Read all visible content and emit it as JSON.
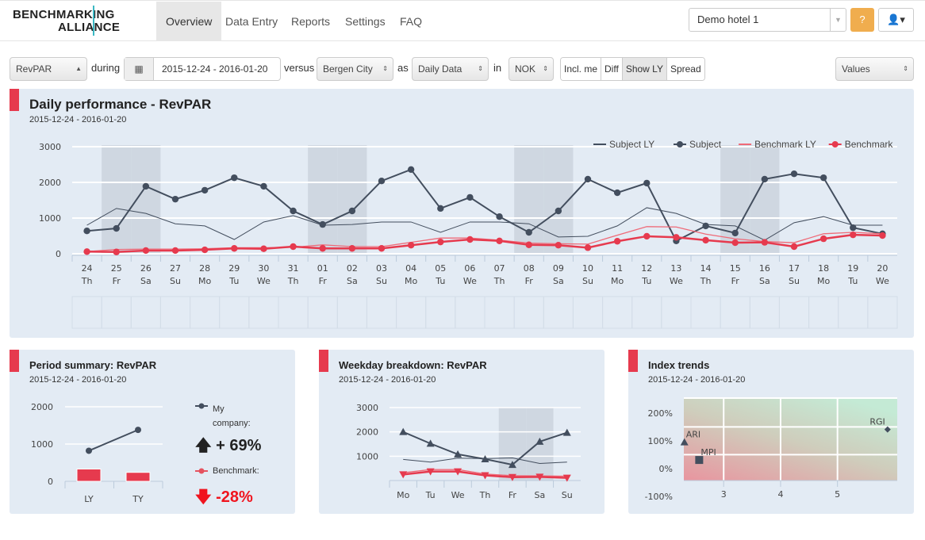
{
  "nav": {
    "logo_line1": "BENCHMARKING",
    "logo_line2": "ALLIANCE",
    "items": [
      {
        "label": "Overview",
        "active": true
      },
      {
        "label": "Data Entry"
      },
      {
        "label": "Reports"
      },
      {
        "label": "Settings"
      },
      {
        "label": "FAQ"
      }
    ],
    "hotel": "Demo hotel 1",
    "help": "?",
    "user_icon": "user-icon"
  },
  "filters": {
    "metric": "RevPAR",
    "during": "during",
    "date_range": "2015-12-24 - 2016-01-20",
    "versus": "versus",
    "benchmark": "Bergen City",
    "as": "as",
    "granularity": "Daily Data",
    "in": "in",
    "currency": "NOK",
    "toggles": [
      {
        "label": "Incl. me",
        "on": false
      },
      {
        "label": "Diff",
        "on": false
      },
      {
        "label": "Show LY",
        "on": true
      },
      {
        "label": "Spread",
        "on": false
      }
    ],
    "display": "Values"
  },
  "colors": {
    "accent": "#e63a4e",
    "subject": "#434e5e",
    "benchmark": "#e63a4e",
    "weekend_band": "#cfd7e1"
  },
  "main": {
    "title": "Daily performance - RevPAR",
    "subtitle": "2015-12-24 - 2016-01-20"
  },
  "summary": {
    "title": "Period summary: RevPAR",
    "subtitle": "2015-12-24 - 2016-01-20",
    "my_label_1": "My",
    "my_label_2": "company:",
    "my_change": "+ 69%",
    "bench_label": "Benchmark:",
    "bench_change": "-28%"
  },
  "weekday": {
    "title": "Weekday breakdown: RevPAR",
    "subtitle": "2015-12-24 - 2016-01-20"
  },
  "index": {
    "title": "Index trends",
    "subtitle": "2015-12-24 - 2016-01-20"
  },
  "chart_data": [
    {
      "type": "line",
      "ylim": [
        0,
        3000
      ],
      "yticks": [
        "0",
        "1000",
        "2000",
        "3000"
      ],
      "categories": [
        "24",
        "25",
        "26",
        "27",
        "28",
        "29",
        "30",
        "31",
        "01",
        "02",
        "03",
        "04",
        "05",
        "06",
        "07",
        "08",
        "09",
        "10",
        "11",
        "12",
        "13",
        "14",
        "15",
        "16",
        "17",
        "18",
        "19",
        "20"
      ],
      "weekdays": [
        "Th",
        "Fr",
        "Sa",
        "Su",
        "Mo",
        "Tu",
        "We",
        "Th",
        "Fr",
        "Sa",
        "Su",
        "Mo",
        "Tu",
        "We",
        "Th",
        "Fr",
        "Sa",
        "Su",
        "Mo",
        "Tu",
        "We",
        "Th",
        "Fr",
        "Sa",
        "Su",
        "Mo",
        "Tu",
        "We"
      ],
      "shaded_weekdays": [
        "Fr",
        "Sa"
      ],
      "legend": "top-right",
      "series": [
        {
          "name": "Subject LY",
          "values": [
            800,
            1270,
            1130,
            840,
            780,
            400,
            890,
            1070,
            800,
            820,
            890,
            890,
            600,
            890,
            890,
            840,
            470,
            490,
            780,
            1290,
            1130,
            820,
            780,
            380,
            870,
            1040,
            800,
            800
          ]
        },
        {
          "name": "Subject",
          "values": [
            640,
            710,
            1890,
            1530,
            1780,
            2130,
            1890,
            1200,
            820,
            1200,
            2040,
            2360,
            1270,
            1580,
            1040,
            600,
            1200,
            2090,
            1710,
            1980,
            360,
            780,
            580,
            2090,
            2240,
            2130,
            730,
            560
          ]
        },
        {
          "name": "Benchmark LY",
          "values": [
            60,
            120,
            130,
            130,
            140,
            170,
            170,
            180,
            250,
            200,
            200,
            320,
            440,
            440,
            380,
            300,
            280,
            270,
            520,
            760,
            750,
            550,
            420,
            340,
            310,
            560,
            600,
            560
          ]
        },
        {
          "name": "Benchmark",
          "values": [
            60,
            50,
            90,
            90,
            110,
            150,
            140,
            200,
            150,
            150,
            150,
            240,
            330,
            400,
            360,
            250,
            240,
            170,
            350,
            490,
            460,
            380,
            310,
            320,
            200,
            420,
            530,
            510
          ]
        }
      ]
    },
    {
      "type": "bar",
      "ylim": [
        0,
        2000
      ],
      "yticks": [
        "0",
        "1000",
        "2000"
      ],
      "categories": [
        "LY",
        "TY"
      ],
      "series": [
        {
          "name": "My company",
          "kind": "line",
          "values": [
            820,
            1380
          ]
        },
        {
          "name": "Benchmark",
          "kind": "bar",
          "values": [
            330,
            240
          ]
        }
      ]
    },
    {
      "type": "line",
      "ylim": [
        0,
        3000
      ],
      "yticks": [
        "1000",
        "2000",
        "3000"
      ],
      "categories": [
        "Mo",
        "Tu",
        "We",
        "Th",
        "Fr",
        "Sa",
        "Su"
      ],
      "shaded": [
        "Fr",
        "Sa"
      ],
      "series": [
        {
          "values": [
            870,
            760,
            920,
            900,
            930,
            700,
            760
          ]
        },
        {
          "values": [
            2000,
            1520,
            1080,
            880,
            650,
            1600,
            1970
          ]
        },
        {
          "values": [
            320,
            450,
            450,
            270,
            200,
            190,
            180
          ]
        },
        {
          "values": [
            250,
            370,
            370,
            210,
            140,
            150,
            110
          ]
        }
      ]
    },
    {
      "type": "scatter",
      "xlim": [
        2.3,
        6.05
      ],
      "ylim": [
        -43,
        254
      ],
      "xticks": [
        "3",
        "4",
        "5"
      ],
      "yticks": [
        "-100%",
        "0%",
        "100%",
        "200%"
      ],
      "points": [
        {
          "label": "ARI",
          "x": 2.31,
          "y": 95,
          "marker": "triangle"
        },
        {
          "label": "MPI",
          "x": 2.57,
          "y": 31,
          "marker": "square"
        },
        {
          "label": "RGI",
          "x": 5.88,
          "y": 141,
          "marker": "diamond"
        }
      ]
    }
  ]
}
